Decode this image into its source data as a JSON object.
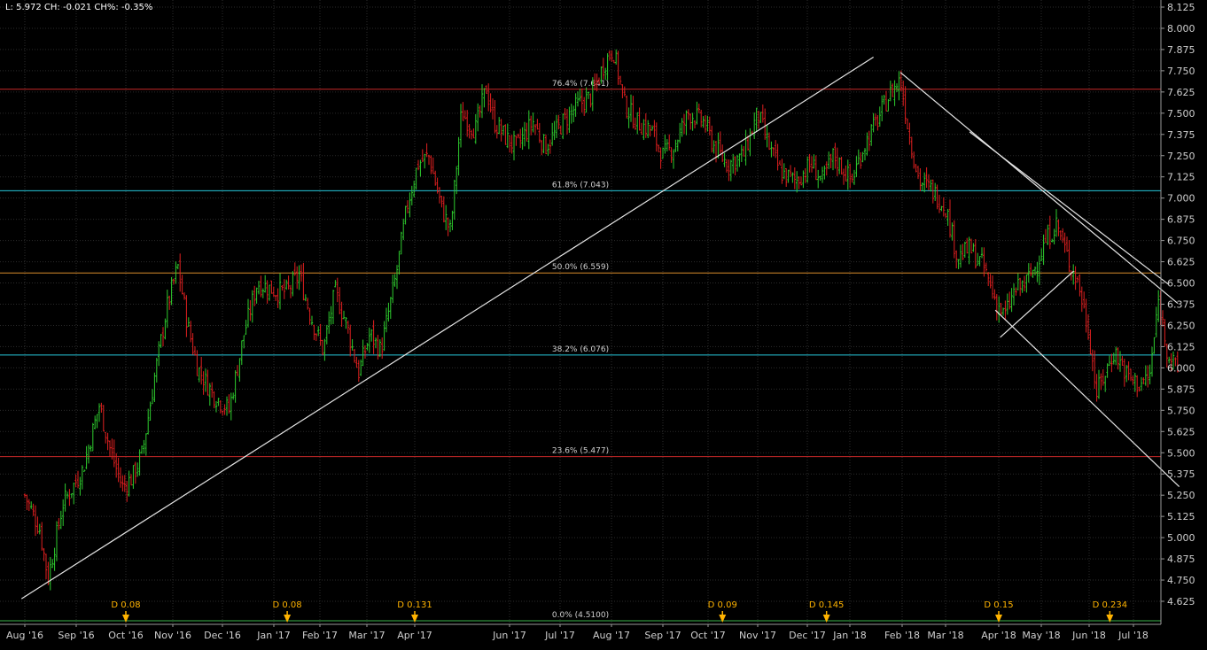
{
  "header": {
    "info": "L: 5.972 CH: -0.021 CH%: -0.35%"
  },
  "colors": {
    "background": "#000000",
    "grid": "#2b2b2b",
    "axis_text": "#cfcfcf",
    "up": "#2ecc2e",
    "down": "#e02020",
    "trendline": "#e6e6e6",
    "fib_red": "#c62828",
    "fib_cyan": "#26c6da",
    "fib_orange": "#d98c2b",
    "fib_green": "#3cb44b",
    "dividend": "#ffb300"
  },
  "chart_data": {
    "type": "candlestick",
    "title": "",
    "xlabel": "",
    "ylabel": "",
    "ylim": [
      4.58,
      8.14
    ],
    "xlim": [
      "2016-08-01",
      "2018-07-31"
    ],
    "grid": true,
    "y_ticks": [
      8.125,
      8.0,
      7.875,
      7.75,
      7.625,
      7.5,
      7.375,
      7.25,
      7.125,
      7.0,
      6.875,
      6.75,
      6.625,
      6.5,
      6.375,
      6.25,
      6.125,
      6.0,
      5.875,
      5.75,
      5.625,
      5.5,
      5.375,
      5.25,
      5.125,
      5.0,
      4.875,
      4.75,
      4.625
    ],
    "y_tick_labels": [
      "8.125",
      "8.000",
      "7.875",
      "7.750",
      "7.625",
      "7.500",
      "7.375",
      "7.250",
      "7.125",
      "7.000",
      "6.875",
      "6.750",
      "6.625",
      "6.500",
      "6.375",
      "6.250",
      "6.125",
      "6.000",
      "5.875",
      "5.750",
      "5.625",
      "5.500",
      "5.375",
      "5.250",
      "5.125",
      "5.000",
      "4.875",
      "4.750",
      "4.625"
    ],
    "x_ticks": [
      {
        "label": "Aug '16",
        "date": "2016-08-01"
      },
      {
        "label": "Sep '16",
        "date": "2016-09-01"
      },
      {
        "label": "Oct '16",
        "date": "2016-10-01"
      },
      {
        "label": "Nov '16",
        "date": "2016-11-01"
      },
      {
        "label": "Dec '16",
        "date": "2016-12-01"
      },
      {
        "label": "Jan '17",
        "date": "2017-01-01"
      },
      {
        "label": "Feb '17",
        "date": "2017-02-01"
      },
      {
        "label": "Mar '17",
        "date": "2017-03-01"
      },
      {
        "label": "Apr '17",
        "date": "2017-04-01"
      },
      {
        "label": "Jun '17",
        "date": "2017-06-01"
      },
      {
        "label": "Jul '17",
        "date": "2017-07-01"
      },
      {
        "label": "Aug '17",
        "date": "2017-08-01"
      },
      {
        "label": "Sep '17",
        "date": "2017-09-01"
      },
      {
        "label": "Oct '17",
        "date": "2017-10-01"
      },
      {
        "label": "Nov '17",
        "date": "2017-11-01"
      },
      {
        "label": "Dec '17",
        "date": "2017-12-01"
      },
      {
        "label": "Jan '18",
        "date": "2018-01-01"
      },
      {
        "label": "Feb '18",
        "date": "2018-02-01"
      },
      {
        "label": "Mar '18",
        "date": "2018-03-01"
      },
      {
        "label": "Apr '18",
        "date": "2018-04-01"
      },
      {
        "label": "May '18",
        "date": "2018-05-01"
      },
      {
        "label": "Jun '18",
        "date": "2018-06-01"
      },
      {
        "label": "Jul '18",
        "date": "2018-07-01"
      }
    ],
    "price_path": [
      [
        "2016-08-01",
        5.25
      ],
      [
        "2016-08-10",
        5.05
      ],
      [
        "2016-08-15",
        4.76
      ],
      [
        "2016-08-24",
        5.2
      ],
      [
        "2016-09-05",
        5.4
      ],
      [
        "2016-09-15",
        5.78
      ],
      [
        "2016-09-22",
        5.5
      ],
      [
        "2016-09-29",
        5.3
      ],
      [
        "2016-10-05",
        5.35
      ],
      [
        "2016-10-12",
        5.5
      ],
      [
        "2016-10-20",
        5.95
      ],
      [
        "2016-10-28",
        6.35
      ],
      [
        "2016-11-04",
        6.6
      ],
      [
        "2016-11-10",
        6.25
      ],
      [
        "2016-11-16",
        6.0
      ],
      [
        "2016-11-25",
        5.85
      ],
      [
        "2016-12-05",
        5.75
      ],
      [
        "2016-12-14",
        6.2
      ],
      [
        "2016-12-22",
        6.5
      ],
      [
        "2017-01-03",
        6.45
      ],
      [
        "2017-01-10",
        6.45
      ],
      [
        "2017-01-18",
        6.55
      ],
      [
        "2017-01-26",
        6.3
      ],
      [
        "2017-02-03",
        6.1
      ],
      [
        "2017-02-10",
        6.45
      ],
      [
        "2017-02-17",
        6.25
      ],
      [
        "2017-02-24",
        5.97
      ],
      [
        "2017-03-03",
        6.2
      ],
      [
        "2017-03-10",
        6.1
      ],
      [
        "2017-03-20",
        6.55
      ],
      [
        "2017-03-27",
        6.95
      ],
      [
        "2017-04-03",
        7.2
      ],
      [
        "2017-04-10",
        7.25
      ],
      [
        "2017-04-18",
        6.95
      ],
      [
        "2017-04-24",
        6.8
      ],
      [
        "2017-05-01",
        7.5
      ],
      [
        "2017-05-10",
        7.4
      ],
      [
        "2017-05-17",
        7.65
      ],
      [
        "2017-05-22",
        7.45
      ],
      [
        "2017-05-30",
        7.35
      ],
      [
        "2017-06-05",
        7.3
      ],
      [
        "2017-06-15",
        7.45
      ],
      [
        "2017-06-22",
        7.3
      ],
      [
        "2017-07-03",
        7.45
      ],
      [
        "2017-07-12",
        7.55
      ],
      [
        "2017-07-20",
        7.6
      ],
      [
        "2017-07-28",
        7.8
      ],
      [
        "2017-08-02",
        7.88
      ],
      [
        "2017-08-09",
        7.55
      ],
      [
        "2017-08-16",
        7.45
      ],
      [
        "2017-08-25",
        7.4
      ],
      [
        "2017-09-01",
        7.25
      ],
      [
        "2017-09-08",
        7.3
      ],
      [
        "2017-09-18",
        7.5
      ],
      [
        "2017-09-28",
        7.45
      ],
      [
        "2017-10-05",
        7.3
      ],
      [
        "2017-10-13",
        7.2
      ],
      [
        "2017-10-23",
        7.25
      ],
      [
        "2017-11-01",
        7.5
      ],
      [
        "2017-11-08",
        7.3
      ],
      [
        "2017-11-15",
        7.15
      ],
      [
        "2017-11-24",
        7.1
      ],
      [
        "2017-12-04",
        7.2
      ],
      [
        "2017-12-12",
        7.1
      ],
      [
        "2017-12-20",
        7.25
      ],
      [
        "2018-01-02",
        7.1
      ],
      [
        "2018-01-09",
        7.3
      ],
      [
        "2018-01-17",
        7.45
      ],
      [
        "2018-01-24",
        7.6
      ],
      [
        "2018-01-31",
        7.7
      ],
      [
        "2018-02-06",
        7.35
      ],
      [
        "2018-02-12",
        7.1
      ],
      [
        "2018-02-20",
        7.05
      ],
      [
        "2018-03-01",
        6.95
      ],
      [
        "2018-03-08",
        6.65
      ],
      [
        "2018-03-15",
        6.7
      ],
      [
        "2018-03-23",
        6.6
      ],
      [
        "2018-03-30",
        6.4
      ],
      [
        "2018-04-05",
        6.3
      ],
      [
        "2018-04-12",
        6.45
      ],
      [
        "2018-04-20",
        6.5
      ],
      [
        "2018-04-27",
        6.6
      ],
      [
        "2018-05-04",
        6.75
      ],
      [
        "2018-05-11",
        6.85
      ],
      [
        "2018-05-18",
        6.65
      ],
      [
        "2018-05-25",
        6.5
      ],
      [
        "2018-06-01",
        6.2
      ],
      [
        "2018-06-06",
        5.85
      ],
      [
        "2018-06-11",
        5.95
      ],
      [
        "2018-06-18",
        6.1
      ],
      [
        "2018-06-27",
        5.95
      ],
      [
        "2018-07-05",
        5.9
      ],
      [
        "2018-07-12",
        5.95
      ],
      [
        "2018-07-18",
        6.4
      ],
      [
        "2018-07-24",
        6.1
      ],
      [
        "2018-07-31",
        5.97
      ]
    ],
    "fibonacci_levels": [
      {
        "label": "76.4% (7.641)",
        "value": 7.641,
        "color": "#c62828"
      },
      {
        "label": "61.8% (7.043)",
        "value": 7.043,
        "color": "#26c6da"
      },
      {
        "label": "50.0% (6.559)",
        "value": 6.559,
        "color": "#d98c2b"
      },
      {
        "label": "38.2% (6.076)",
        "value": 6.076,
        "color": "#26c6da"
      },
      {
        "label": "23.6% (5.477)",
        "value": 5.477,
        "color": "#c62828"
      },
      {
        "label": "0.0% (4.5100)",
        "value": 4.51,
        "color": "#3cb44b"
      }
    ],
    "trendlines": [
      {
        "from": [
          "2016-07-30",
          4.64
        ],
        "to": [
          "2018-01-15",
          7.83
        ]
      },
      {
        "from": [
          "2018-01-31",
          7.74
        ],
        "to": [
          "2018-07-31",
          6.38
        ]
      },
      {
        "from": [
          "2018-03-15",
          7.39
        ],
        "to": [
          "2018-07-25",
          6.49
        ]
      },
      {
        "from": [
          "2018-03-30",
          6.34
        ],
        "to": [
          "2018-08-01",
          5.3
        ]
      },
      {
        "from": [
          "2018-04-02",
          6.18
        ],
        "to": [
          "2018-05-22",
          6.57
        ]
      }
    ],
    "dividends": [
      {
        "label": "D 0.08",
        "date": "2016-10-01"
      },
      {
        "label": "D 0.08",
        "date": "2017-01-10"
      },
      {
        "label": "D 0.131",
        "date": "2017-04-01"
      },
      {
        "label": "D 0.09",
        "date": "2017-10-10"
      },
      {
        "label": "D 0.145",
        "date": "2017-12-15"
      },
      {
        "label": "D 0.15",
        "date": "2018-04-01"
      },
      {
        "label": "D 0.234",
        "date": "2018-06-15"
      }
    ]
  }
}
